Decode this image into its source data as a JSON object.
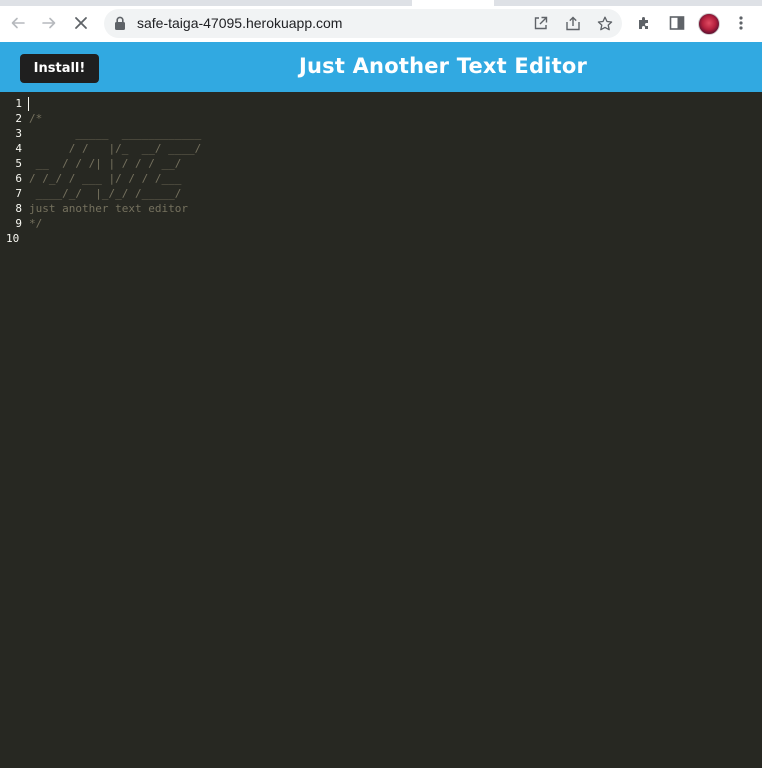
{
  "browser": {
    "url": "safe-taiga-47095.herokuapp.com"
  },
  "app": {
    "install_label": "Install!",
    "title": "Just Another Text Editor"
  },
  "editor": {
    "line_numbers": [
      "1",
      "2",
      "3",
      "4",
      "5",
      "6",
      "7",
      "8",
      "9",
      "10"
    ],
    "lines": [
      "",
      "/*",
      "       _____  ____________",
      "      / /   |/_  __/ ____/",
      " __  / / /| | / / / __/",
      "/ /_/ / ___ |/ / / /___",
      " ____/_/  |_/_/ /_____/",
      "just another text editor",
      "*/",
      ""
    ]
  },
  "colors": {
    "header": "#31a9e1",
    "editor_bg": "#272822",
    "comment": "#75715e",
    "install_bg": "#1f1f1f"
  }
}
